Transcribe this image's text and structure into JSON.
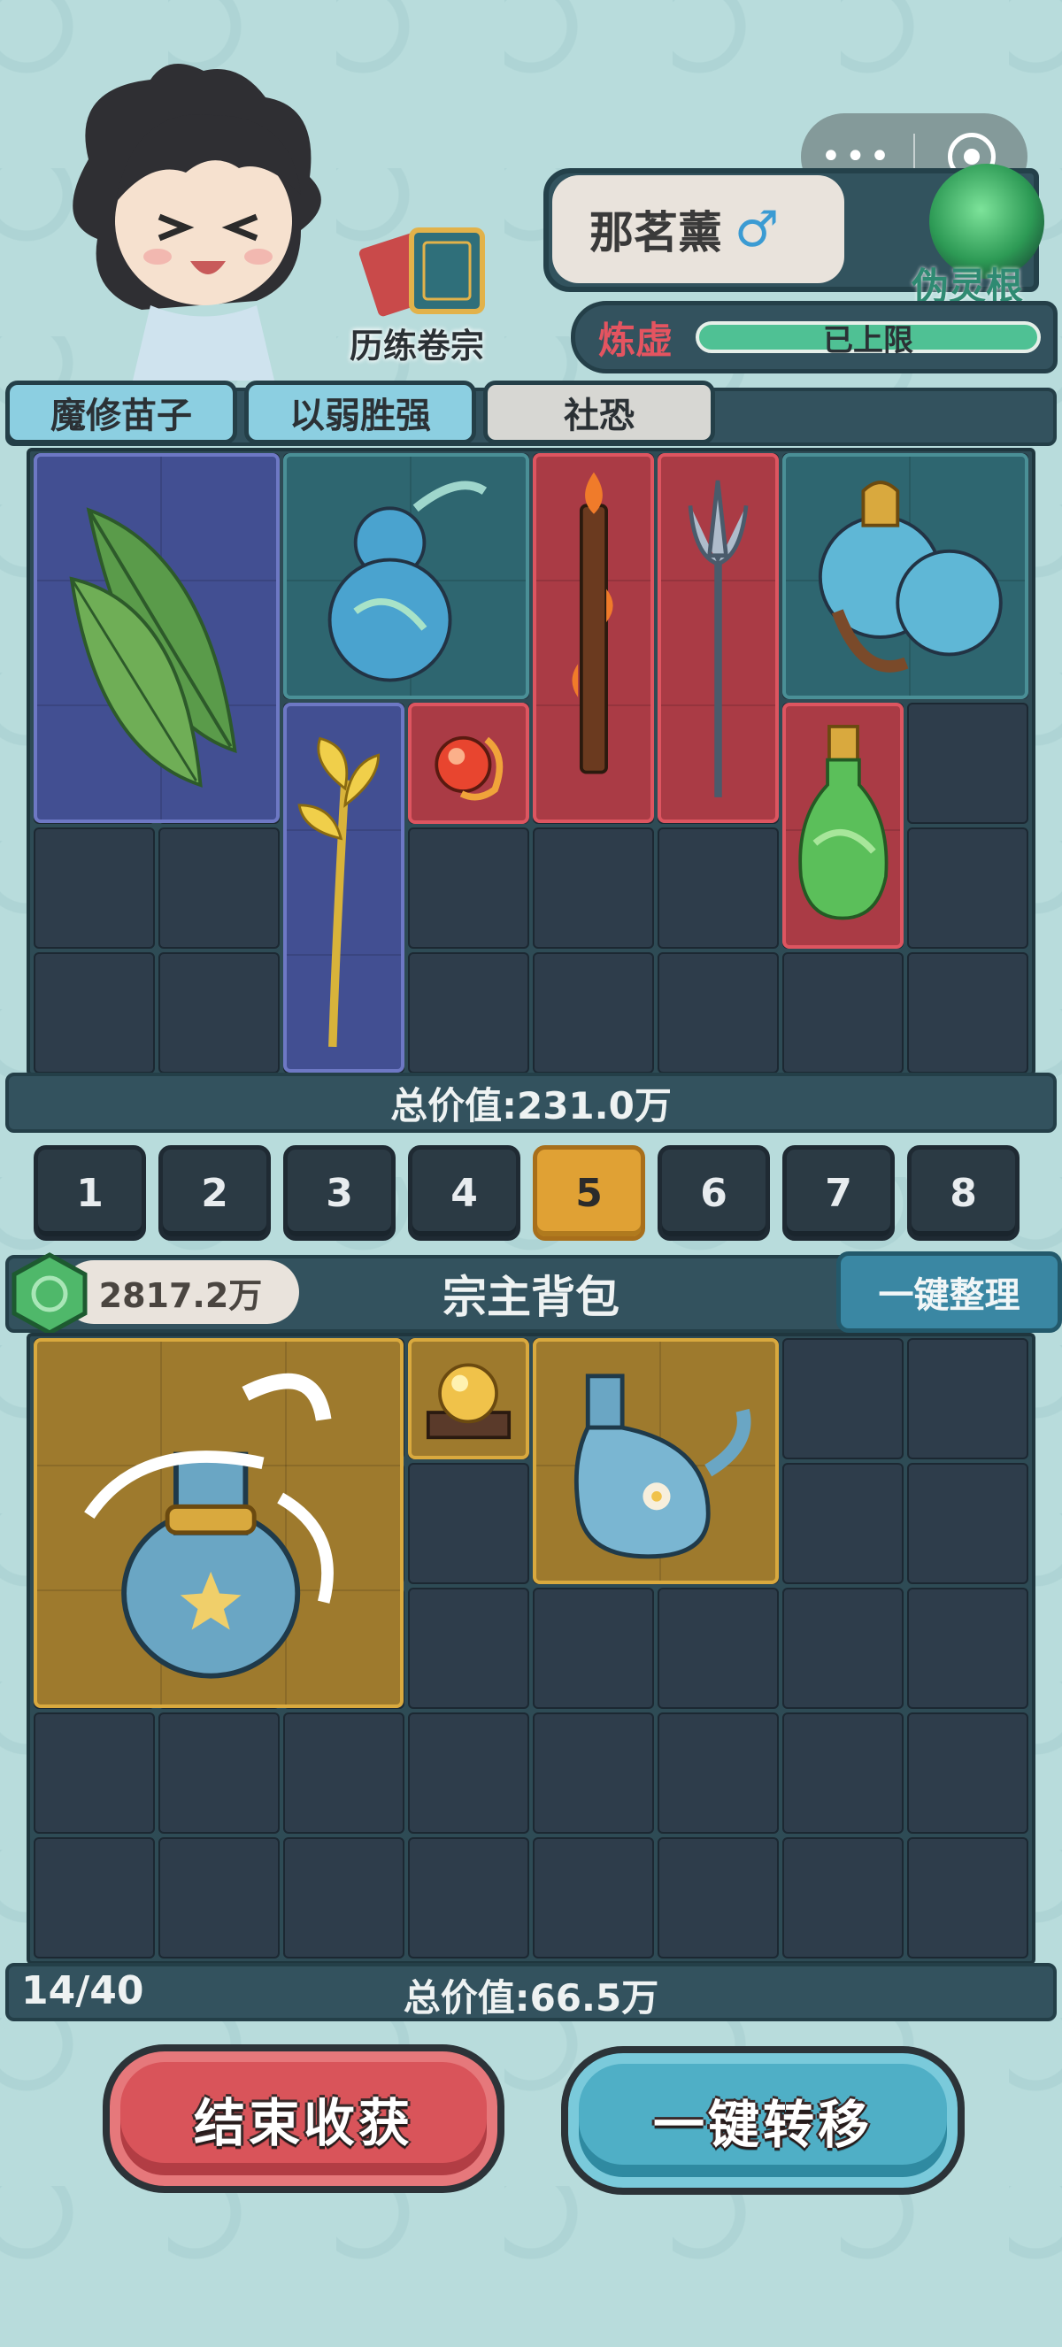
{
  "capsule": {
    "dots": "•••"
  },
  "player": {
    "name": "那茗薰",
    "gender_symbol": "♂",
    "spirit_root": "伪灵根",
    "book_label": "历练卷宗"
  },
  "realm": {
    "name": "炼虚",
    "progress_text": "已上限",
    "progress": 1.0
  },
  "tags": [
    "魔修苗子",
    "以弱胜强",
    "社恐"
  ],
  "loot": {
    "total_label": "总价值:231.0万",
    "items": [
      {
        "name": "spirit-leaf",
        "rarity": "purple"
      },
      {
        "name": "blue-gourd",
        "rarity": "teal"
      },
      {
        "name": "flame-staff",
        "rarity": "red"
      },
      {
        "name": "silver-trident",
        "rarity": "red"
      },
      {
        "name": "gold-gourd-flask",
        "rarity": "teal"
      },
      {
        "name": "golden-herb",
        "rarity": "purple"
      },
      {
        "name": "fire-pearl",
        "rarity": "red"
      },
      {
        "name": "green-potion",
        "rarity": "red"
      }
    ]
  },
  "pages": {
    "labels": [
      "1",
      "2",
      "3",
      "4",
      "5",
      "6",
      "7",
      "8"
    ],
    "active": "5"
  },
  "bag": {
    "money": "2817.2万",
    "title": "宗主背包",
    "sort_label": "一键整理",
    "capacity": "14/40",
    "total_label": "总价值:66.5万",
    "items": [
      {
        "name": "star-vase",
        "rarity": "gold"
      },
      {
        "name": "golden-orb-pedestal",
        "rarity": "gold"
      },
      {
        "name": "flower-teapot",
        "rarity": "gold"
      }
    ]
  },
  "actions": {
    "end_label": "结束收获",
    "transfer_label": "一键转移"
  },
  "colors": {
    "background": "#b8dcdc",
    "panel": "#33525e",
    "active_page": "#e0a134",
    "red_button": "#d9545a",
    "blue_button": "#4fafc6"
  }
}
